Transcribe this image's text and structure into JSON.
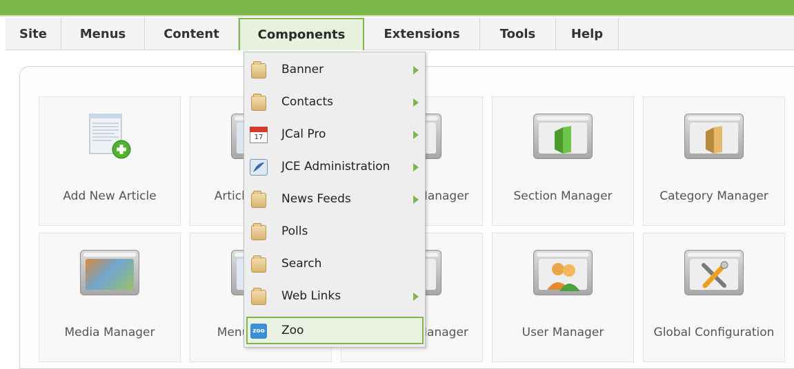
{
  "menubar": {
    "items": [
      {
        "label": "Site",
        "active": false
      },
      {
        "label": "Menus",
        "active": false
      },
      {
        "label": "Content",
        "active": false
      },
      {
        "label": "Components",
        "active": true
      },
      {
        "label": "Extensions",
        "active": false
      },
      {
        "label": "Tools",
        "active": false
      },
      {
        "label": "Help",
        "active": false
      }
    ]
  },
  "dropdown": {
    "items": [
      {
        "label": "Banner",
        "icon": "folder-icon",
        "submenu": true
      },
      {
        "label": "Contacts",
        "icon": "folder-icon",
        "submenu": true
      },
      {
        "label": "JCal Pro",
        "icon": "calendar-icon",
        "submenu": true,
        "icon_text": "17"
      },
      {
        "label": "JCE Administration",
        "icon": "jce-feather-icon",
        "submenu": true
      },
      {
        "label": "News Feeds",
        "icon": "folder-icon",
        "submenu": true
      },
      {
        "label": "Polls",
        "icon": "folder-icon",
        "submenu": false
      },
      {
        "label": "Search",
        "icon": "folder-icon",
        "submenu": false
      },
      {
        "label": "Web Links",
        "icon": "folder-icon",
        "submenu": true
      },
      {
        "label": "Zoo",
        "icon": "zoo-icon",
        "submenu": false,
        "selected": true,
        "icon_text": "zoo"
      }
    ]
  },
  "quickicons": {
    "row1": [
      {
        "label": "Add New Article",
        "icon": "add-article-icon"
      },
      {
        "label": "Article Manager",
        "icon": "article-manager-icon"
      },
      {
        "label": "Frontpage Manager",
        "icon": "frontpage-manager-icon"
      },
      {
        "label": "Section Manager",
        "icon": "section-manager-icon"
      },
      {
        "label": "Category Manager",
        "icon": "category-manager-icon"
      }
    ],
    "row2": [
      {
        "label": "Media Manager",
        "icon": "media-manager-icon"
      },
      {
        "label": "Menu Manager",
        "icon": "menu-manager-icon"
      },
      {
        "label": "Language Manager",
        "icon": "language-manager-icon"
      },
      {
        "label": "User Manager",
        "icon": "user-manager-icon"
      },
      {
        "label": "Global Configuration",
        "icon": "global-configuration-icon"
      }
    ]
  },
  "colors": {
    "accent_green": "#7fb84a",
    "menu_bg": "#f4f4f4",
    "dropdown_bg": "#eeeeee",
    "selected_bg": "#e9f1e1"
  }
}
